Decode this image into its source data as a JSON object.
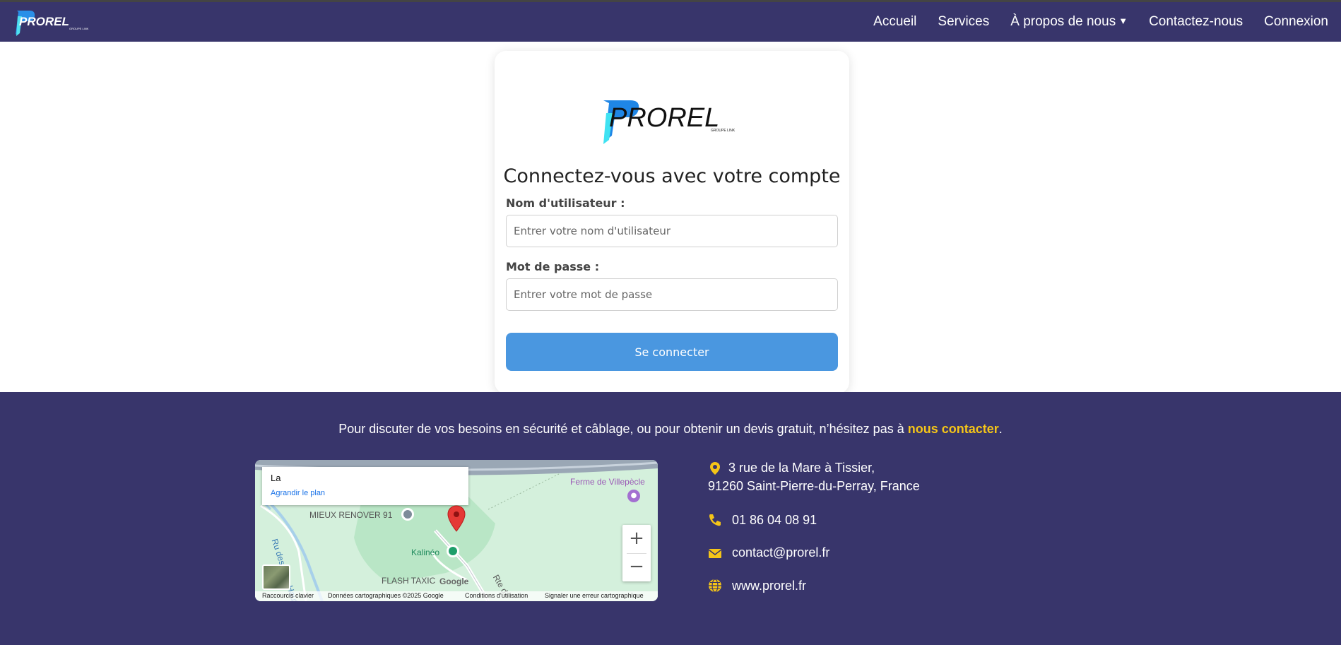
{
  "nav": {
    "logo_text": "PROREL",
    "links": [
      {
        "label": "Accueil"
      },
      {
        "label": "Services"
      },
      {
        "label": "À propos de nous"
      },
      {
        "label": "Contactez-nous"
      },
      {
        "label": "Connexion"
      }
    ]
  },
  "login": {
    "logo_text": "PROREL",
    "logo_subtext": "GROUPE LINK",
    "title": "Connectez-vous avec votre compte",
    "username_label": "Nom d'utilisateur :",
    "username_placeholder": "Entrer votre nom d'utilisateur",
    "password_label": "Mot de passe :",
    "password_placeholder": "Entrer votre mot de passe",
    "submit_label": "Se connecter"
  },
  "footer": {
    "text_before": "Pour discuter de vos besoins en sécurité et câblage, ou pour obtenir un devis gratuit, n’hésitez pas à ",
    "text_link": "nous contacter",
    "text_after": ".",
    "map": {
      "card_title": "La",
      "card_link": "Agrandir le plan",
      "labels": {
        "ferme": "Ferme de Villepècle",
        "mieux": "MIEUX RENOVER 91",
        "kalineo": "Kalinéo",
        "flash": "FLASH TAXIC",
        "rue": "Ru des Prés Hauts",
        "rte": "Rte d",
        "google": "Google"
      },
      "zoom_in": "+",
      "zoom_out": "−",
      "footer_items": [
        "Raccourcis clavier",
        "Données cartographiques ©2025 Google",
        "Conditions d'utilisation",
        "Signaler une erreur cartographique"
      ]
    },
    "contact": {
      "address_line1": "3 rue de la Mare à Tissier,",
      "address_line2": "91260 Saint-Pierre-du-Perray, France",
      "phone": "01 86 04 08 91",
      "email": "contact@prorel.fr",
      "website": "www.prorel.fr"
    }
  },
  "colors": {
    "nav_bg": "#38356b",
    "accent_yellow": "#f5c518",
    "button_blue": "#4a97e0"
  }
}
